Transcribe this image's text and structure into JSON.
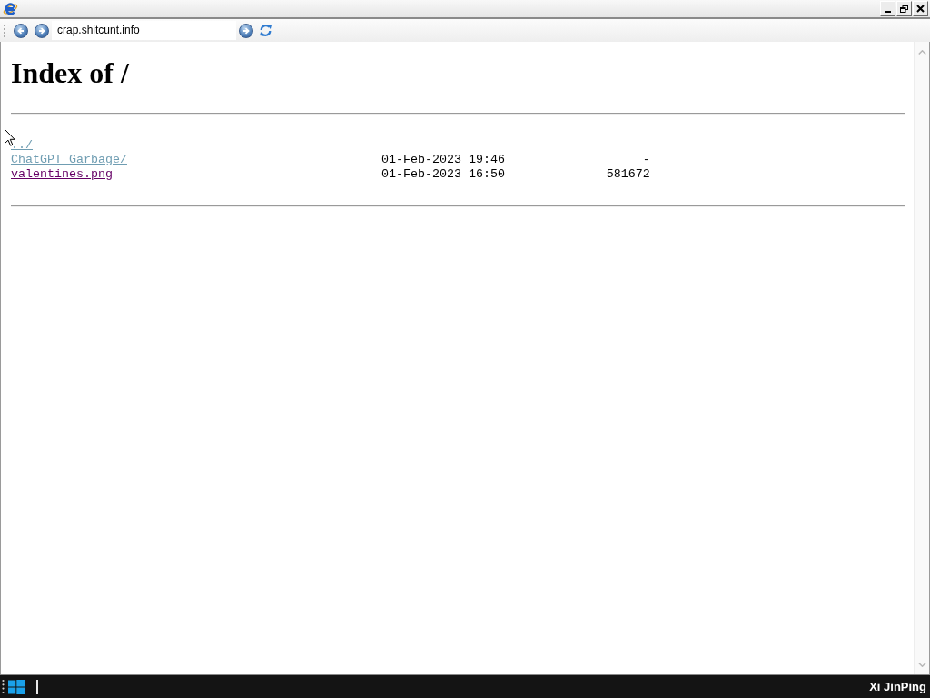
{
  "address_bar": {
    "url": "crap.shitcunt.info"
  },
  "page": {
    "heading": "Index of /",
    "entries": [
      {
        "name": "../",
        "color": "#6f9db2"
      },
      {
        "name": "ChatGPT Garbage/",
        "date": "01-Feb-2023 19:46",
        "size": "-",
        "color": "#6f9db2"
      },
      {
        "name": "valentines.png",
        "date": "01-Feb-2023 16:50",
        "size": "581672",
        "color": "#660066"
      }
    ]
  },
  "taskbar": {
    "user": "Xi JinPing"
  }
}
